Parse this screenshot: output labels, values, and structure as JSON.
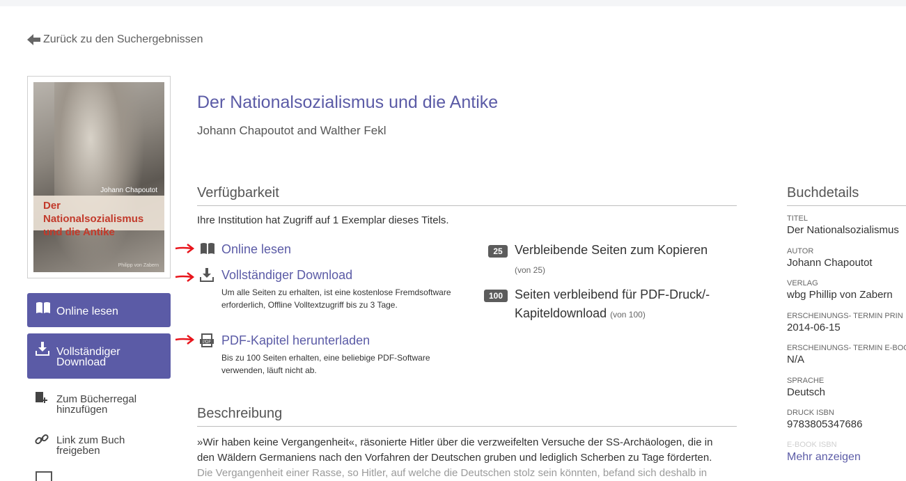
{
  "back_link": "Zurück zu den Suchergebnissen",
  "cover": {
    "author": "Johann Chapoutot",
    "title": "Der Nationalsozialismus und die Antike",
    "publisher": "Philipp von Zabern"
  },
  "sidebar": {
    "read_online": "Online lesen",
    "full_download": "Vollständiger Download",
    "add_shelf": "Zum Bücherregal hinzufügen",
    "share_link": "Link zum Buch freigeben"
  },
  "book": {
    "title": "Der Nationalsozialismus und die Antike",
    "authors": "Johann Chapoutot and Walther Fekl"
  },
  "availability": {
    "heading": "Verfügbarkeit",
    "access_text": "Ihre Institution hat Zugriff auf 1 Exemplar dieses Titels.",
    "options": [
      {
        "label": "Online lesen",
        "icon": "book-open-icon",
        "note": ""
      },
      {
        "label": "Vollständiger Download",
        "icon": "download-icon",
        "note": "Um alle Seiten zu erhalten, ist eine kostenlose Fremdsoftware erforderlich, Offline Volltextzugriff bis zu 3 Tage."
      },
      {
        "label": "PDF-Kapitel herunterladen",
        "icon": "pdf-icon",
        "note": "Bis zu 100 Seiten erhalten, eine beliebige PDF-Software verwenden, läuft nicht ab."
      }
    ],
    "copy_quota": {
      "badge": "25",
      "label": "Verbleibende Seiten zum Kopieren",
      "sub": "(von 25)"
    },
    "print_quota": {
      "badge": "100",
      "label_line1": "Seiten verbleibend für PDF-Druck/-",
      "label_line2": "Kapiteldownload",
      "sub": "(von 100)"
    }
  },
  "description": {
    "heading": "Beschreibung",
    "line1": "»Wir haben keine Vergangenheit«, räsonierte Hitler über die verzweifelten Versuche der SS-Archäologen, die in",
    "line2": "den Wäldern Germaniens nach den Vorfahren der Deutschen gruben und lediglich Scherben zu Tage förderten.",
    "line3": "Die Vergangenheit einer Rasse, so Hitler, auf welche die Deutschen stolz sein könnten, befand sich deshalb in"
  },
  "details": {
    "heading": "Buchdetails",
    "items": [
      {
        "label": "Titel",
        "value": "Der Nationalsozialismus"
      },
      {
        "label": "Autor",
        "value": "Johann Chapoutot"
      },
      {
        "label": "Verlag",
        "value": "wbg Phillip von Zabern"
      },
      {
        "label": "Erscheinungs- Termin Prin",
        "value": "2014-06-15"
      },
      {
        "label": "Erscheinungs- Termin E-Boo",
        "value": "N/A"
      },
      {
        "label": "Sprache",
        "value": "Deutsch"
      },
      {
        "label": "Druck ISBN",
        "value": "9783805347686"
      },
      {
        "label": "E-Book ISBN",
        "value": ""
      }
    ],
    "more": "Mehr anzeigen"
  },
  "colors": {
    "accent": "#5b5ba6",
    "annotation_arrow": "#e8141b"
  }
}
